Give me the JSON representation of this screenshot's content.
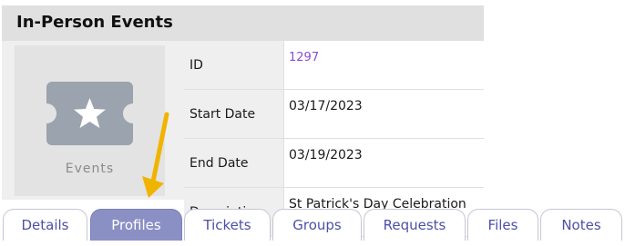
{
  "panel": {
    "title": "In-Person Events",
    "thumbnail": {
      "icon": "ticket-star-icon",
      "label": "Events"
    }
  },
  "details": [
    {
      "label": "ID",
      "value": "1297"
    },
    {
      "label": "Start Date",
      "value": "03/17/2023"
    },
    {
      "label": "End Date",
      "value": "03/19/2023"
    },
    {
      "label": "Description",
      "value": "St Patrick's Day Celebration"
    }
  ],
  "tabs": [
    {
      "label": "Details",
      "active": false
    },
    {
      "label": "Profiles",
      "active": true
    },
    {
      "label": "Tickets",
      "active": false
    },
    {
      "label": "Groups",
      "active": false
    },
    {
      "label": "Requests",
      "active": false
    },
    {
      "label": "Files",
      "active": false
    },
    {
      "label": "Notes",
      "active": false
    }
  ],
  "annotation": {
    "icon": "arrow-pointer-icon",
    "color": "#f0b400"
  },
  "colors": {
    "link": "#8a4ad8",
    "tab_text": "#4d4fa8",
    "tab_active_bg": "#8a8fc4"
  }
}
